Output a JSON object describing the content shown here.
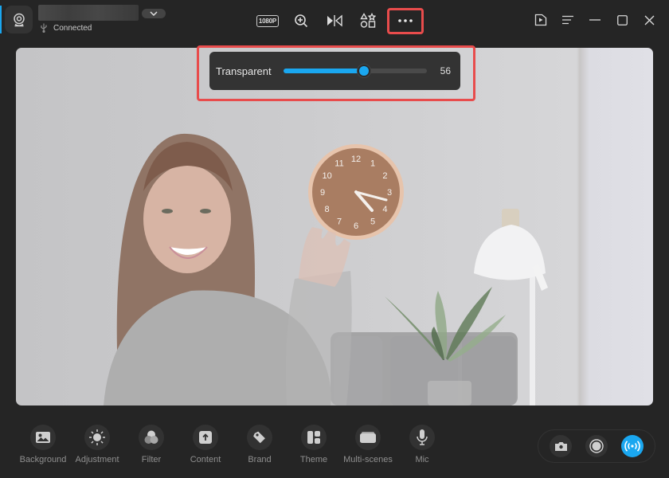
{
  "app": {
    "accent_color": "#1aa7f0",
    "highlight_color": "#e84c4c",
    "device": {
      "name_redacted": true,
      "status": "Connected",
      "status_icon": "usb-icon",
      "app_icon": "webcam-icon"
    }
  },
  "toolbar": {
    "resolution_label": "1080P",
    "items": [
      {
        "name": "resolution",
        "icon": "resolution-badge"
      },
      {
        "name": "zoom",
        "icon": "zoom-in-icon"
      },
      {
        "name": "mirror",
        "icon": "mirror-flip-icon"
      },
      {
        "name": "widgets",
        "icon": "shapes-icon"
      },
      {
        "name": "more",
        "icon": "more-dots-icon",
        "highlighted": true
      }
    ]
  },
  "window_controls": [
    {
      "name": "recordings",
      "icon": "video-folder-icon"
    },
    {
      "name": "menu",
      "icon": "menu-icon"
    },
    {
      "name": "minimize",
      "icon": "minimize-icon"
    },
    {
      "name": "maximize",
      "icon": "maximize-icon"
    },
    {
      "name": "close",
      "icon": "close-icon"
    }
  ],
  "transparency": {
    "label": "Transparent",
    "value": 56,
    "display_value": "56",
    "min": 0,
    "max": 100
  },
  "bottom_bar": {
    "items": [
      {
        "label": "Background",
        "icon": "image-icon"
      },
      {
        "label": "Adjustment",
        "icon": "sun-icon"
      },
      {
        "label": "Filter",
        "icon": "filter-circles-icon"
      },
      {
        "label": "Content",
        "icon": "upload-icon"
      },
      {
        "label": "Brand",
        "icon": "tag-icon"
      },
      {
        "label": "Theme",
        "icon": "layout-icon"
      },
      {
        "label": "Multi-scenes",
        "icon": "scenes-icon"
      },
      {
        "label": "Mic",
        "icon": "microphone-icon"
      }
    ]
  },
  "capture": {
    "items": [
      {
        "name": "snapshot",
        "icon": "camera-icon",
        "active": false
      },
      {
        "name": "record",
        "icon": "record-icon",
        "active": false
      },
      {
        "name": "live",
        "icon": "broadcast-icon",
        "active": true
      }
    ]
  },
  "preview": {
    "clock_numbers": [
      "12",
      "1",
      "2",
      "3",
      "4",
      "5",
      "6",
      "7",
      "8",
      "9",
      "10",
      "11"
    ]
  }
}
